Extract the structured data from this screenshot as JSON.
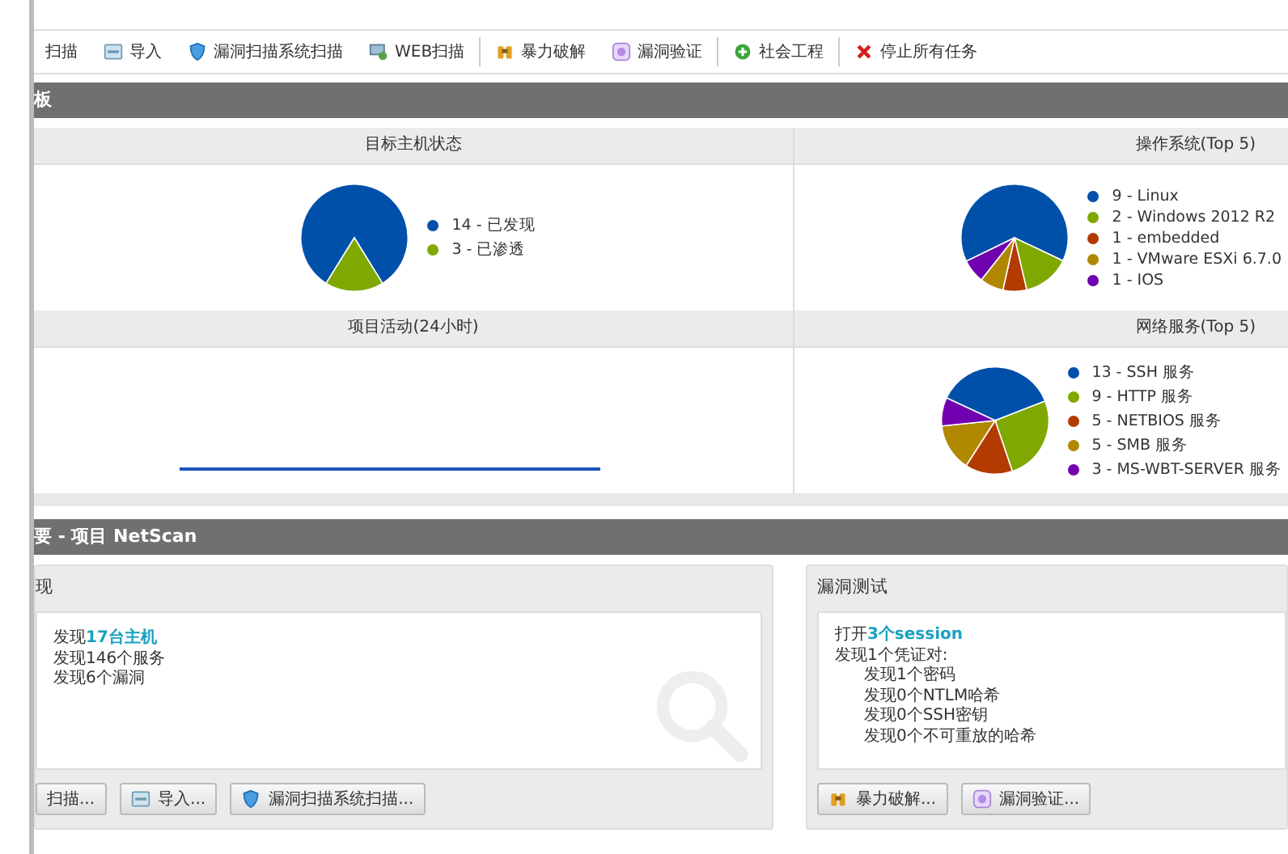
{
  "toolbar": {
    "groups": [
      [
        {
          "label": "扫描",
          "kind": "none"
        },
        {
          "label": "导入",
          "kind": "import"
        },
        {
          "label": "漏洞扫描系统扫描",
          "kind": "shield"
        },
        {
          "label": "WEB扫描",
          "kind": "web"
        }
      ],
      [
        {
          "label": "暴力破解",
          "kind": "brute"
        },
        {
          "label": "漏洞验证",
          "kind": "verify"
        }
      ],
      [
        {
          "label": "社会工程",
          "kind": "social"
        }
      ],
      [
        {
          "label": "停止所有任务",
          "kind": "stop"
        }
      ]
    ]
  },
  "dashboard": {
    "title": "板",
    "panels": [
      {
        "kind": "pie",
        "chart_data": {
          "type": "pie",
          "title": "目标主机状态",
          "categories": [
            "14 - 已发现",
            "3 - 已渗透"
          ],
          "series": [
            {
              "values": [
                14,
                3
              ]
            }
          ],
          "colors": [
            "#0050aa",
            "#7fa800"
          ]
        }
      },
      {
        "kind": "pie",
        "chart_data": {
          "type": "pie",
          "title": "操作系统(Top 5)",
          "categories": [
            "9 - Linux",
            "2 - Windows 2012 R2",
            "1 - embedded",
            "1 - VMware ESXi 6.7.0",
            "1 - IOS"
          ],
          "series": [
            {
              "values": [
                9,
                2,
                1,
                1,
                1
              ]
            }
          ],
          "colors": [
            "#0050aa",
            "#7fa800",
            "#b33a00",
            "#b08800",
            "#7000b0"
          ]
        }
      },
      {
        "kind": "activity",
        "title": "项目活动(24小时)"
      },
      {
        "kind": "pie",
        "chart_data": {
          "type": "pie",
          "title": "网络服务(Top 5)",
          "categories": [
            "13 - SSH 服务",
            "9 - HTTP 服务",
            "5 - NETBIOS 服务",
            "5 - SMB 服务",
            "3 - MS-WBT-SERVER 服务"
          ],
          "series": [
            {
              "values": [
                13,
                9,
                5,
                5,
                3
              ]
            }
          ],
          "colors": [
            "#0050aa",
            "#7fa800",
            "#b33a00",
            "#b08800",
            "#7000b0"
          ]
        }
      }
    ]
  },
  "overview": {
    "title": "要 - 项目 NetScan",
    "boxes": [
      {
        "title": "现",
        "lines": [
          {
            "text": "发现**17台主机**"
          },
          {
            "text": "发现146个服务"
          },
          {
            "text": "发现6个漏洞"
          }
        ],
        "buttons": [
          {
            "label": "扫描...",
            "kind": "none"
          },
          {
            "label": "导入...",
            "kind": "import"
          },
          {
            "label": "漏洞扫描系统扫描...",
            "kind": "shield"
          }
        ]
      },
      {
        "title": "漏洞测试",
        "lines": [
          {
            "text": "打开**3个session**"
          },
          {
            "text": "发现1个凭证对:",
            "children": [
              {
                "text": "发现1个密码"
              },
              {
                "text": "发现0个NTLM哈希"
              },
              {
                "text": "发现0个SSH密钥"
              },
              {
                "text": "发现0个不可重放的哈希"
              }
            ]
          }
        ],
        "buttons": [
          {
            "label": "暴力破解...",
            "kind": "brute"
          },
          {
            "label": "漏洞验证...",
            "kind": "verify"
          }
        ]
      }
    ]
  }
}
